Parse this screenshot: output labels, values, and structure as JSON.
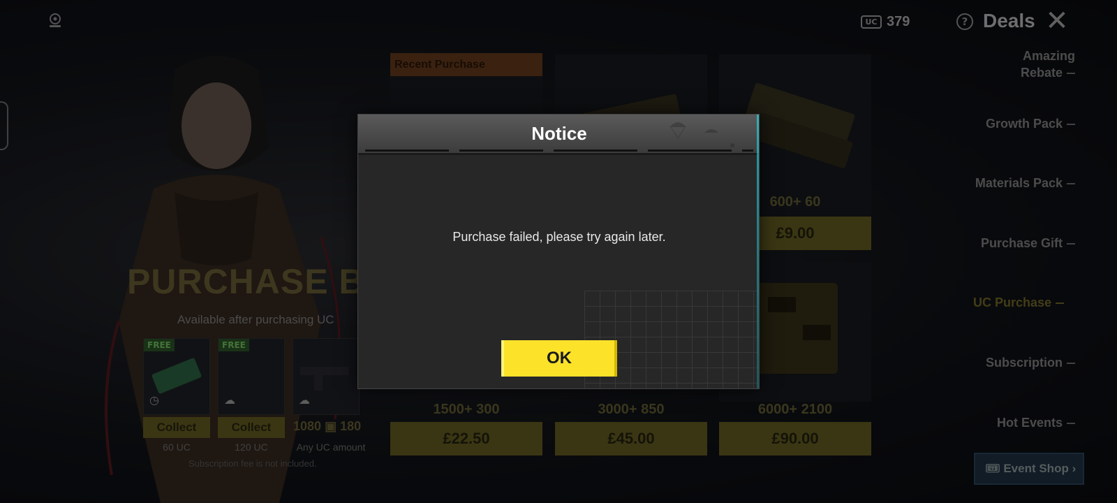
{
  "topbar": {
    "uc_chip": "UC",
    "uc_balance": "379",
    "help_symbol": "?",
    "title": "Deals",
    "close_symbol": "✕"
  },
  "bonus": {
    "title": "PURCHASE BONU",
    "subtitle": "Available after purchasing UC",
    "rewards": [
      {
        "tag": "FREE",
        "button": "Collect",
        "caption": "60 UC"
      },
      {
        "tag": "FREE",
        "button": "Collect",
        "caption": "120 UC"
      },
      {
        "tag": "",
        "button": "",
        "caption": "Any UC amount"
      }
    ],
    "third_amount": "1080",
    "third_bonus": "180",
    "note": "Subscription fee is not included."
  },
  "products": {
    "recent_label": "Recent Purchase",
    "items": [
      {
        "line": "600+  60",
        "price": "£9.00"
      },
      {
        "line": "1500+  300",
        "price": "£22.50"
      },
      {
        "line": "3000+  850",
        "price": "£45.00"
      },
      {
        "line": "6000+  2100",
        "price": "£90.00"
      }
    ]
  },
  "menu": {
    "items": [
      {
        "label": "Amazing Rebate",
        "active": false
      },
      {
        "label": "Growth Pack",
        "active": false
      },
      {
        "label": "Materials Pack",
        "active": false
      },
      {
        "label": "Purchase Gift",
        "active": false
      },
      {
        "label": "UC Purchase",
        "active": true
      },
      {
        "label": "Subscription",
        "active": false
      },
      {
        "label": "Hot Events",
        "active": false
      }
    ],
    "event_shop": "Event Shop"
  },
  "dialog": {
    "title": "Notice",
    "message": "Purchase failed, please try again later.",
    "ok_label": "OK"
  },
  "colors": {
    "accent_yellow": "#fde22a",
    "dim_gold": "#6b6323",
    "active_menu": "#7a6f2a"
  },
  "icons": [
    "mic-icon",
    "uc-icon",
    "help-icon",
    "close-icon",
    "clock-icon",
    "cloud-icon",
    "chevron-right-icon",
    "ticket-icon"
  ]
}
